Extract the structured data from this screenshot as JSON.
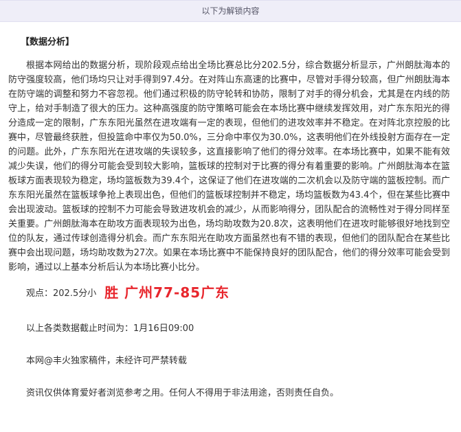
{
  "banner": {
    "text": "以下为解锁内容"
  },
  "section_title": "【数据分析】",
  "analysis_paragraph": "根据本网给出的数据分析，现阶段观点给出全场比赛总比分202.5分，综合数据分析显示，广州朗肽海本的防守强度较高，他们场均只让对手得到97.4分。在对阵山东高速的比赛中，尽管对手得分较高，但广州朗肽海本在防守端的调整和努力不容忽视。他们通过积极的防守轮转和协防，限制了对手的得分机会，尤其是在内线的防守上，给对手制造了很大的压力。这种高强度的防守策略可能会在本场比赛中继续发挥效用，对广东东阳光的得分造成一定的限制，广东东阳光虽然在进攻端有一定的表现，但他们的进攻效率并不稳定。在对阵北京控股的比赛中，尽管最终获胜，但投篮命中率仅为50.0%，三分命中率仅为30.0%，这表明他们在外线投射方面存在一定的问题。此外，广东东阳光在进攻端的失误较多，这直接影响了他们的得分效率。在本场比赛中，如果不能有效减少失误，他们的得分可能会受到较大影响，篮板球的控制对于比赛的得分有着重要的影响。广州朗肽海本在篮板球方面表现较为稳定，场均篮板数为39.4个，这保证了他们在进攻端的二次机会以及防守端的篮板控制。而广东东阳光虽然在篮板球争抢上表现出色，但他们的篮板球控制并不稳定，场均篮板数为43.4个，但在某些比赛中会出现波动。篮板球的控制不力可能会导致进攻机会的减少，从而影响得分，团队配合的流畅性对于得分同样至关重要。广州朗肽海本在助攻方面表现较为出色，场均助攻数为20.8次，这表明他们在进攻时能够很好地找到空位的队友，通过传球创造得分机会。而广东东阳光在助攻方面虽然也有不错的表现，但他们的团队配合在某些比赛中会出现问题，场均助攻数为27次。如果在本场比赛中不能保持良好的团队配合，他们的得分效率可能会受到影响，通过以上基本分析后认为本场比赛小比分。",
  "verdict": {
    "label": "观点：202.5分小",
    "pick": "胜  广州77-85广东",
    "pick_color": "#e8262d"
  },
  "deadline": "以上各类数据截止时间为：1月16日09:00",
  "copyright": "本网@丰火独家稿件，未经许可严禁转载",
  "disclaimer": "资讯仅供体育爱好者浏览参考之用。任何人不得用于非法用途，否则责任自负。"
}
